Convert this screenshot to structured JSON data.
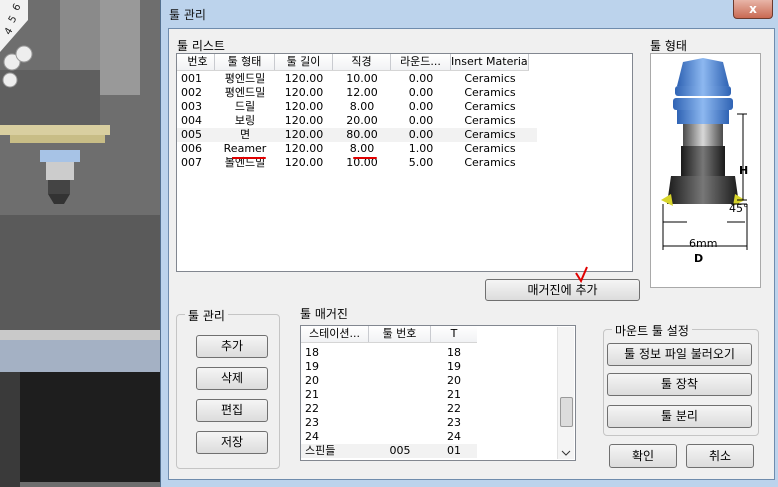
{
  "window": {
    "title": "툴 관리",
    "close_glyph": "x"
  },
  "tool_list": {
    "label": "툴 리스트",
    "columns": [
      "번호",
      "툴 형태",
      "툴 길이",
      "직경",
      "라운드...",
      "Insert Material"
    ],
    "rows": [
      [
        "001",
        "평엔드밀",
        "120.00",
        "10.00",
        "0.00",
        "Ceramics"
      ],
      [
        "002",
        "평엔드밀",
        "120.00",
        "12.00",
        "0.00",
        "Ceramics"
      ],
      [
        "003",
        "드릴",
        "120.00",
        "8.00",
        "0.00",
        "Ceramics"
      ],
      [
        "004",
        "보링",
        "120.00",
        "20.00",
        "0.00",
        "Ceramics"
      ],
      [
        "005",
        "면",
        "120.00",
        "80.00",
        "0.00",
        "Ceramics"
      ],
      [
        "006",
        "Reamer",
        "120.00",
        "8.00",
        "1.00",
        "Ceramics"
      ],
      [
        "007",
        "볼엔드밀",
        "120.00",
        "10.00",
        "5.00",
        "Ceramics"
      ]
    ],
    "selected_row": 4
  },
  "tool_shape": {
    "label": "툴 형태",
    "dim_h": "H",
    "dim_angle": "45°",
    "dim_width": "6mm",
    "dim_d": "D"
  },
  "add_to_magazine_button": "매거진에 추가",
  "tool_management": {
    "label": "툴 관리",
    "buttons": [
      "추가",
      "삭제",
      "편집",
      "저장"
    ]
  },
  "tool_magazine": {
    "label": "툴 매거진",
    "columns": [
      "스테이션...",
      "툴 번호",
      "T"
    ],
    "rows": [
      [
        "18",
        "",
        "18"
      ],
      [
        "19",
        "",
        "19"
      ],
      [
        "20",
        "",
        "20"
      ],
      [
        "21",
        "",
        "21"
      ],
      [
        "22",
        "",
        "22"
      ],
      [
        "23",
        "",
        "23"
      ],
      [
        "24",
        "",
        "24"
      ],
      [
        "스핀들",
        "005",
        "01"
      ]
    ]
  },
  "mount_tool_settings": {
    "label": "마운트 툴 설정",
    "buttons": [
      "툴 정보 파일 불러오기",
      "툴 장착",
      "툴 분리"
    ]
  },
  "dialog_buttons": {
    "ok": "확인",
    "cancel": "취소"
  },
  "background": {
    "ruler_digits": [
      "4",
      "5",
      "6"
    ]
  },
  "colors": {
    "dialog_frame": "#bcd3ec",
    "client_bg": "#f0f0f0",
    "close_button": "#c96a53",
    "annotation_red": "#e00000",
    "tool_holder_blue": "#4f86d6"
  }
}
